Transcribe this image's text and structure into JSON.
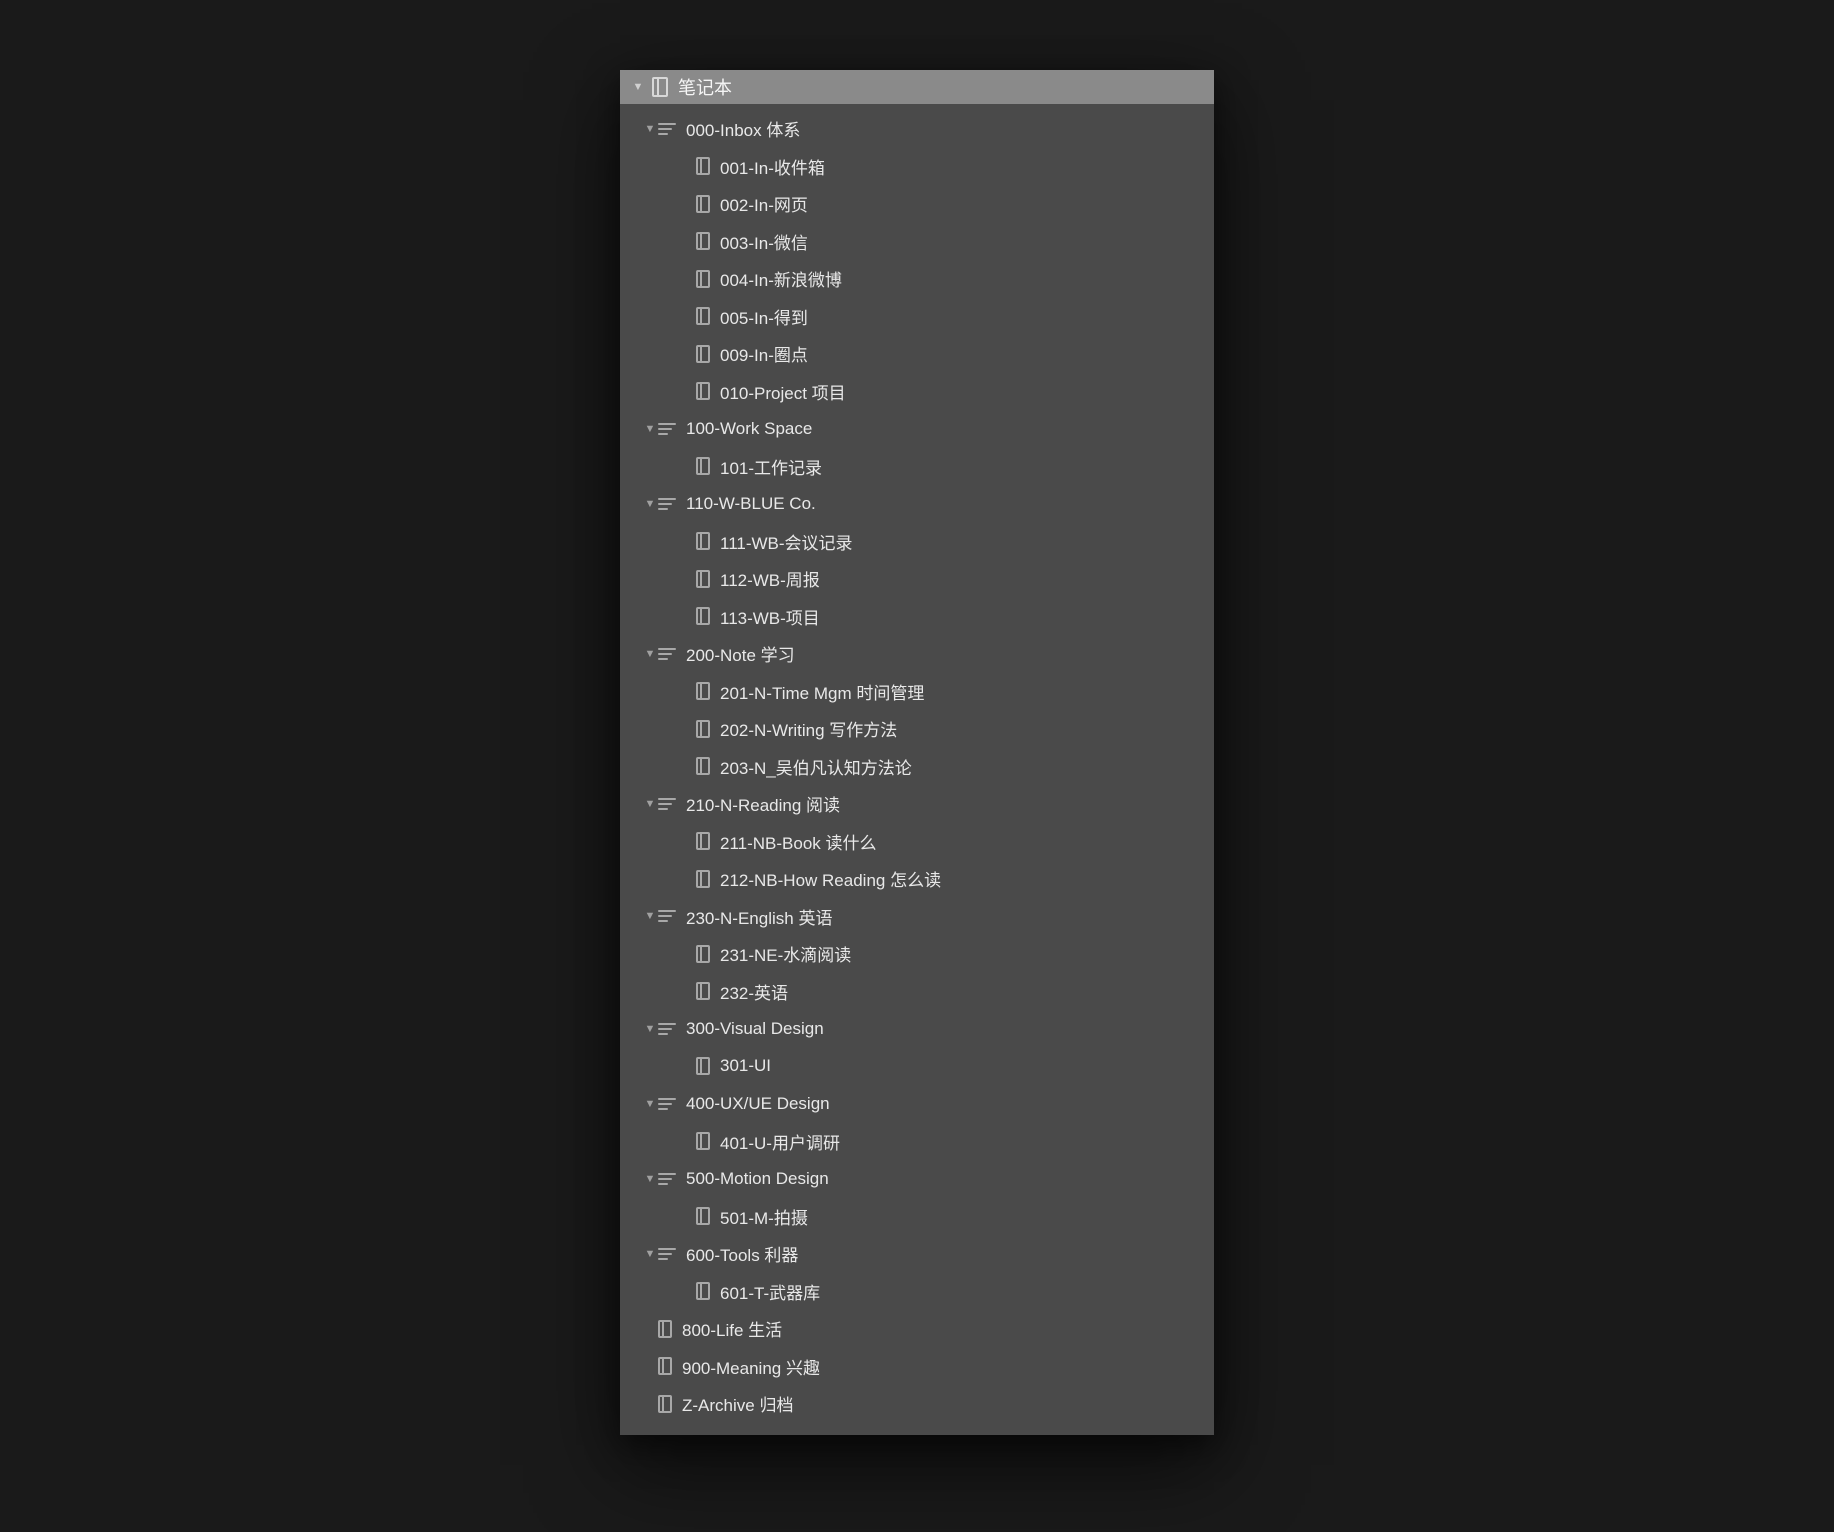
{
  "header": {
    "title": "笔记本"
  },
  "tree": [
    {
      "type": "stack",
      "label": "000-Inbox 体系",
      "children": [
        {
          "type": "notebook",
          "label": "001-In-收件箱"
        },
        {
          "type": "notebook",
          "label": "002-In-网页"
        },
        {
          "type": "notebook",
          "label": "003-In-微信"
        },
        {
          "type": "notebook",
          "label": "004-In-新浪微博"
        },
        {
          "type": "notebook",
          "label": "005-In-得到"
        },
        {
          "type": "notebook",
          "label": "009-In-圈点"
        },
        {
          "type": "notebook",
          "label": "010-Project 项目"
        }
      ]
    },
    {
      "type": "stack",
      "label": "100-Work Space",
      "children": [
        {
          "type": "notebook",
          "label": "101-工作记录"
        }
      ]
    },
    {
      "type": "stack",
      "label": "110-W-BLUE Co.",
      "children": [
        {
          "type": "notebook",
          "label": "111-WB-会议记录"
        },
        {
          "type": "notebook",
          "label": "112-WB-周报"
        },
        {
          "type": "notebook",
          "label": "113-WB-项目"
        }
      ]
    },
    {
      "type": "stack",
      "label": "200-Note 学习",
      "children": [
        {
          "type": "notebook",
          "label": "201-N-Time Mgm 时间管理"
        },
        {
          "type": "notebook",
          "label": "202-N-Writing 写作方法"
        },
        {
          "type": "notebook",
          "label": "203-N_吴伯凡认知方法论"
        }
      ]
    },
    {
      "type": "stack",
      "label": "210-N-Reading 阅读",
      "children": [
        {
          "type": "notebook",
          "label": "211-NB-Book 读什么"
        },
        {
          "type": "notebook",
          "label": "212-NB-How Reading 怎么读"
        }
      ]
    },
    {
      "type": "stack",
      "label": "230-N-English 英语",
      "children": [
        {
          "type": "notebook",
          "label": "231-NE-水滴阅读"
        },
        {
          "type": "notebook",
          "label": "232-英语"
        }
      ]
    },
    {
      "type": "stack",
      "label": "300-Visual Design",
      "children": [
        {
          "type": "notebook",
          "label": "301-UI"
        }
      ]
    },
    {
      "type": "stack",
      "label": "400-UX/UE Design",
      "children": [
        {
          "type": "notebook",
          "label": "401-U-用户调研"
        }
      ]
    },
    {
      "type": "stack",
      "label": "500-Motion Design",
      "children": [
        {
          "type": "notebook",
          "label": "501-M-拍摄"
        }
      ]
    },
    {
      "type": "stack",
      "label": "600-Tools 利器",
      "children": [
        {
          "type": "notebook",
          "label": "601-T-武器库"
        }
      ]
    },
    {
      "type": "notebook",
      "label": "800-Life 生活"
    },
    {
      "type": "notebook",
      "label": "900-Meaning 兴趣"
    },
    {
      "type": "notebook",
      "label": "Z-Archive 归档"
    }
  ]
}
